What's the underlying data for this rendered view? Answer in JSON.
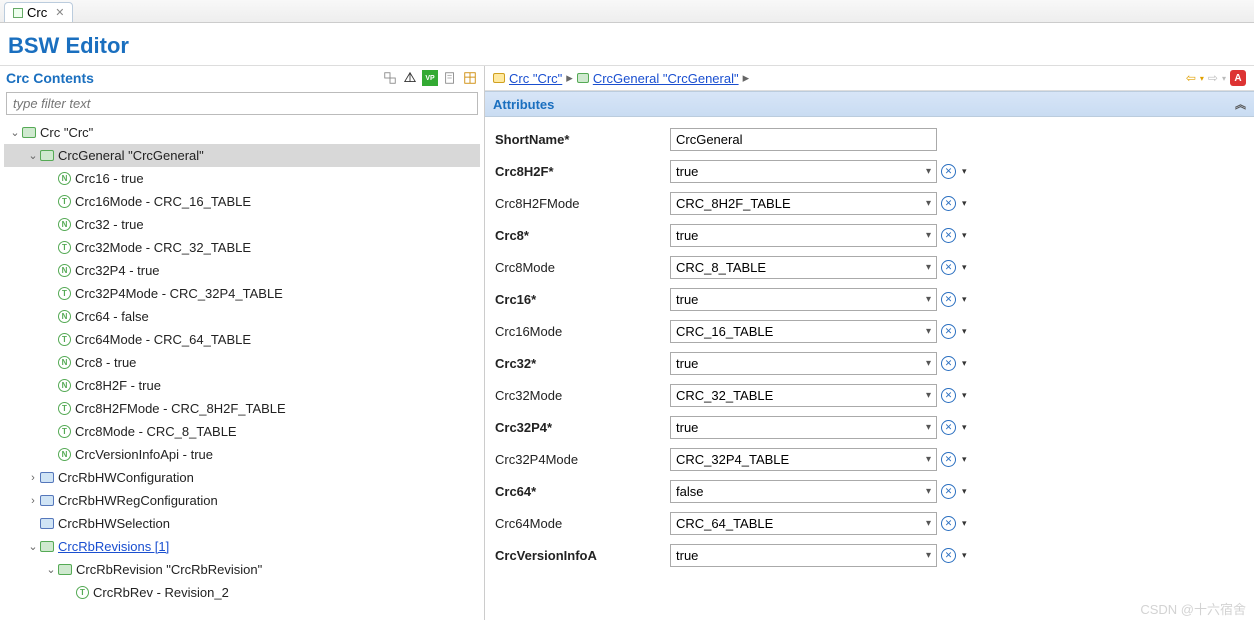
{
  "tab": {
    "label": "Crc"
  },
  "page_title": "BSW Editor",
  "left": {
    "header": "Crc Contents",
    "filter_placeholder": "type filter text",
    "toolbar_icons": [
      "expand-all",
      "collapse-tree",
      "vp",
      "doc",
      "grid"
    ]
  },
  "tree": [
    {
      "depth": 0,
      "expand": "open",
      "icon": "fld-grn",
      "label": "Crc \"Crc\""
    },
    {
      "depth": 1,
      "expand": "open",
      "icon": "fld-grn",
      "label": "CrcGeneral \"CrcGeneral\"",
      "selected": true
    },
    {
      "depth": 2,
      "expand": "none",
      "icon": "n",
      "label": "Crc16 - true"
    },
    {
      "depth": 2,
      "expand": "none",
      "icon": "t",
      "label": "Crc16Mode - CRC_16_TABLE"
    },
    {
      "depth": 2,
      "expand": "none",
      "icon": "n",
      "label": "Crc32 - true"
    },
    {
      "depth": 2,
      "expand": "none",
      "icon": "t",
      "label": "Crc32Mode - CRC_32_TABLE"
    },
    {
      "depth": 2,
      "expand": "none",
      "icon": "n",
      "label": "Crc32P4 - true"
    },
    {
      "depth": 2,
      "expand": "none",
      "icon": "t",
      "label": "Crc32P4Mode - CRC_32P4_TABLE"
    },
    {
      "depth": 2,
      "expand": "none",
      "icon": "n",
      "label": "Crc64 - false"
    },
    {
      "depth": 2,
      "expand": "none",
      "icon": "t",
      "label": "Crc64Mode - CRC_64_TABLE"
    },
    {
      "depth": 2,
      "expand": "none",
      "icon": "n",
      "label": "Crc8 - true"
    },
    {
      "depth": 2,
      "expand": "none",
      "icon": "n",
      "label": "Crc8H2F - true"
    },
    {
      "depth": 2,
      "expand": "none",
      "icon": "t",
      "label": "Crc8H2FMode - CRC_8H2F_TABLE"
    },
    {
      "depth": 2,
      "expand": "none",
      "icon": "t",
      "label": "Crc8Mode - CRC_8_TABLE"
    },
    {
      "depth": 2,
      "expand": "none",
      "icon": "n",
      "label": "CrcVersionInfoApi - true"
    },
    {
      "depth": 1,
      "expand": "closed",
      "icon": "fld-blu",
      "label": "CrcRbHWConfiguration"
    },
    {
      "depth": 1,
      "expand": "closed",
      "icon": "fld-blu",
      "label": "CrcRbHWRegConfiguration"
    },
    {
      "depth": 1,
      "expand": "none",
      "icon": "fld-blu",
      "label": "CrcRbHWSelection"
    },
    {
      "depth": 1,
      "expand": "open",
      "icon": "fld-grn",
      "label": "CrcRbRevisions [1]",
      "link": true
    },
    {
      "depth": 2,
      "expand": "open",
      "icon": "fld-grn",
      "label": "CrcRbRevision \"CrcRbRevision\""
    },
    {
      "depth": 3,
      "expand": "none",
      "icon": "t",
      "label": "CrcRbRev - Revision_2"
    }
  ],
  "breadcrumb": {
    "items": [
      {
        "icon": "sq",
        "label": "Crc \"Crc\""
      },
      {
        "icon": "sqg",
        "label": "CrcGeneral \"CrcGeneral\""
      }
    ]
  },
  "attr_header": "Attributes",
  "attributes": [
    {
      "label": "ShortName*",
      "bold": true,
      "type": "text",
      "value": "CrcGeneral"
    },
    {
      "label": "Crc8H2F*",
      "bold": true,
      "type": "select",
      "value": "true"
    },
    {
      "label": "Crc8H2FMode",
      "bold": false,
      "type": "select",
      "value": "CRC_8H2F_TABLE"
    },
    {
      "label": "Crc8*",
      "bold": true,
      "type": "select",
      "value": "true"
    },
    {
      "label": "Crc8Mode",
      "bold": false,
      "type": "select",
      "value": "CRC_8_TABLE"
    },
    {
      "label": "Crc16*",
      "bold": true,
      "type": "select",
      "value": "true"
    },
    {
      "label": "Crc16Mode",
      "bold": false,
      "type": "select",
      "value": "CRC_16_TABLE"
    },
    {
      "label": "Crc32*",
      "bold": true,
      "type": "select",
      "value": "true"
    },
    {
      "label": "Crc32Mode",
      "bold": false,
      "type": "select",
      "value": "CRC_32_TABLE"
    },
    {
      "label": "Crc32P4*",
      "bold": true,
      "type": "select",
      "value": "true"
    },
    {
      "label": "Crc32P4Mode",
      "bold": false,
      "type": "select",
      "value": "CRC_32P4_TABLE"
    },
    {
      "label": "Crc64*",
      "bold": true,
      "type": "select",
      "value": "false"
    },
    {
      "label": "Crc64Mode",
      "bold": false,
      "type": "select",
      "value": "CRC_64_TABLE"
    },
    {
      "label": "CrcVersionInfoA",
      "bold": true,
      "type": "select",
      "value": "true"
    }
  ],
  "watermark": "CSDN @十六宿舍"
}
